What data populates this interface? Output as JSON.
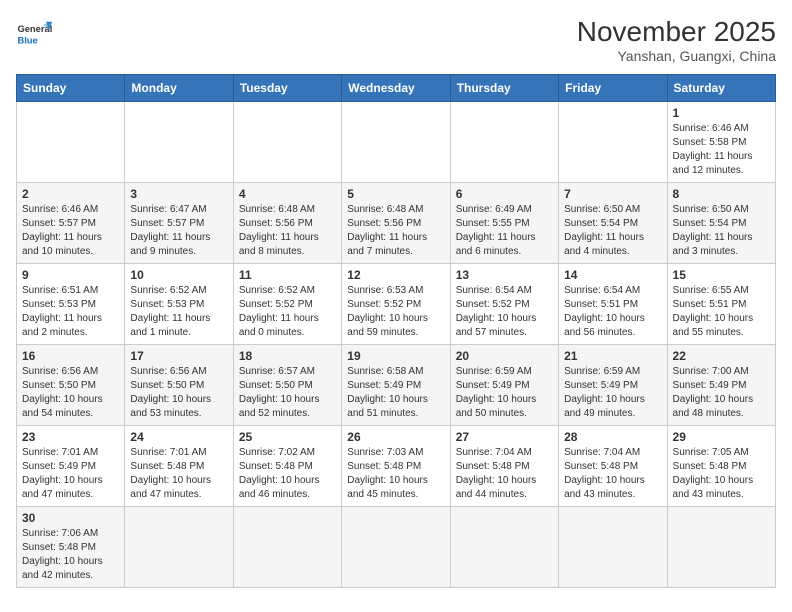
{
  "header": {
    "logo_general": "General",
    "logo_blue": "Blue",
    "month_year": "November 2025",
    "location": "Yanshan, Guangxi, China"
  },
  "days_of_week": [
    "Sunday",
    "Monday",
    "Tuesday",
    "Wednesday",
    "Thursday",
    "Friday",
    "Saturday"
  ],
  "weeks": [
    [
      {
        "day": "",
        "info": ""
      },
      {
        "day": "",
        "info": ""
      },
      {
        "day": "",
        "info": ""
      },
      {
        "day": "",
        "info": ""
      },
      {
        "day": "",
        "info": ""
      },
      {
        "day": "",
        "info": ""
      },
      {
        "day": "1",
        "info": "Sunrise: 6:46 AM\nSunset: 5:58 PM\nDaylight: 11 hours and 12 minutes."
      }
    ],
    [
      {
        "day": "2",
        "info": "Sunrise: 6:46 AM\nSunset: 5:57 PM\nDaylight: 11 hours and 10 minutes."
      },
      {
        "day": "3",
        "info": "Sunrise: 6:47 AM\nSunset: 5:57 PM\nDaylight: 11 hours and 9 minutes."
      },
      {
        "day": "4",
        "info": "Sunrise: 6:48 AM\nSunset: 5:56 PM\nDaylight: 11 hours and 8 minutes."
      },
      {
        "day": "5",
        "info": "Sunrise: 6:48 AM\nSunset: 5:56 PM\nDaylight: 11 hours and 7 minutes."
      },
      {
        "day": "6",
        "info": "Sunrise: 6:49 AM\nSunset: 5:55 PM\nDaylight: 11 hours and 6 minutes."
      },
      {
        "day": "7",
        "info": "Sunrise: 6:50 AM\nSunset: 5:54 PM\nDaylight: 11 hours and 4 minutes."
      },
      {
        "day": "8",
        "info": "Sunrise: 6:50 AM\nSunset: 5:54 PM\nDaylight: 11 hours and 3 minutes."
      }
    ],
    [
      {
        "day": "9",
        "info": "Sunrise: 6:51 AM\nSunset: 5:53 PM\nDaylight: 11 hours and 2 minutes."
      },
      {
        "day": "10",
        "info": "Sunrise: 6:52 AM\nSunset: 5:53 PM\nDaylight: 11 hours and 1 minute."
      },
      {
        "day": "11",
        "info": "Sunrise: 6:52 AM\nSunset: 5:52 PM\nDaylight: 11 hours and 0 minutes."
      },
      {
        "day": "12",
        "info": "Sunrise: 6:53 AM\nSunset: 5:52 PM\nDaylight: 10 hours and 59 minutes."
      },
      {
        "day": "13",
        "info": "Sunrise: 6:54 AM\nSunset: 5:52 PM\nDaylight: 10 hours and 57 minutes."
      },
      {
        "day": "14",
        "info": "Sunrise: 6:54 AM\nSunset: 5:51 PM\nDaylight: 10 hours and 56 minutes."
      },
      {
        "day": "15",
        "info": "Sunrise: 6:55 AM\nSunset: 5:51 PM\nDaylight: 10 hours and 55 minutes."
      }
    ],
    [
      {
        "day": "16",
        "info": "Sunrise: 6:56 AM\nSunset: 5:50 PM\nDaylight: 10 hours and 54 minutes."
      },
      {
        "day": "17",
        "info": "Sunrise: 6:56 AM\nSunset: 5:50 PM\nDaylight: 10 hours and 53 minutes."
      },
      {
        "day": "18",
        "info": "Sunrise: 6:57 AM\nSunset: 5:50 PM\nDaylight: 10 hours and 52 minutes."
      },
      {
        "day": "19",
        "info": "Sunrise: 6:58 AM\nSunset: 5:49 PM\nDaylight: 10 hours and 51 minutes."
      },
      {
        "day": "20",
        "info": "Sunrise: 6:59 AM\nSunset: 5:49 PM\nDaylight: 10 hours and 50 minutes."
      },
      {
        "day": "21",
        "info": "Sunrise: 6:59 AM\nSunset: 5:49 PM\nDaylight: 10 hours and 49 minutes."
      },
      {
        "day": "22",
        "info": "Sunrise: 7:00 AM\nSunset: 5:49 PM\nDaylight: 10 hours and 48 minutes."
      }
    ],
    [
      {
        "day": "23",
        "info": "Sunrise: 7:01 AM\nSunset: 5:49 PM\nDaylight: 10 hours and 47 minutes."
      },
      {
        "day": "24",
        "info": "Sunrise: 7:01 AM\nSunset: 5:48 PM\nDaylight: 10 hours and 47 minutes."
      },
      {
        "day": "25",
        "info": "Sunrise: 7:02 AM\nSunset: 5:48 PM\nDaylight: 10 hours and 46 minutes."
      },
      {
        "day": "26",
        "info": "Sunrise: 7:03 AM\nSunset: 5:48 PM\nDaylight: 10 hours and 45 minutes."
      },
      {
        "day": "27",
        "info": "Sunrise: 7:04 AM\nSunset: 5:48 PM\nDaylight: 10 hours and 44 minutes."
      },
      {
        "day": "28",
        "info": "Sunrise: 7:04 AM\nSunset: 5:48 PM\nDaylight: 10 hours and 43 minutes."
      },
      {
        "day": "29",
        "info": "Sunrise: 7:05 AM\nSunset: 5:48 PM\nDaylight: 10 hours and 43 minutes."
      }
    ],
    [
      {
        "day": "30",
        "info": "Sunrise: 7:06 AM\nSunset: 5:48 PM\nDaylight: 10 hours and 42 minutes."
      },
      {
        "day": "",
        "info": ""
      },
      {
        "day": "",
        "info": ""
      },
      {
        "day": "",
        "info": ""
      },
      {
        "day": "",
        "info": ""
      },
      {
        "day": "",
        "info": ""
      },
      {
        "day": "",
        "info": ""
      }
    ]
  ]
}
